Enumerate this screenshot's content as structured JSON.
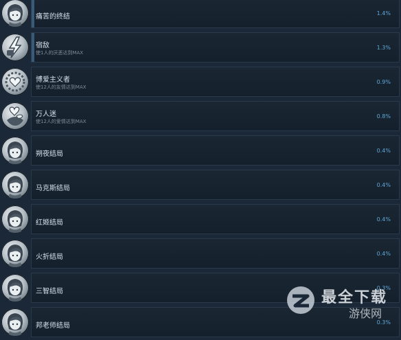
{
  "achievements": [
    {
      "title": "痛苦的终结",
      "desc": "",
      "percent": "1.4%",
      "icon": "anime-character-icon",
      "has_bar": true
    },
    {
      "title": "宿敌",
      "desc": "使1人的厌恶达到MAX",
      "percent": "1.3%",
      "icon": "lightning-fist-icon",
      "has_bar": true
    },
    {
      "title": "博爱主义者",
      "desc": "使12人的友情达到MAX",
      "percent": "0.9%",
      "icon": "heart-ring-icon",
      "has_bar": false
    },
    {
      "title": "万人迷",
      "desc": "使12人的爱情达到MAX",
      "percent": "0.8%",
      "icon": "heart-bouquet-icon",
      "has_bar": false
    },
    {
      "title": "朔夜结局",
      "desc": "",
      "percent": "0.4%",
      "icon": "anime-character-icon",
      "has_bar": false
    },
    {
      "title": "马克斯结局",
      "desc": "",
      "percent": "0.4%",
      "icon": "anime-character-icon",
      "has_bar": false
    },
    {
      "title": "红姬结局",
      "desc": "",
      "percent": "0.4%",
      "icon": "anime-character-icon",
      "has_bar": false
    },
    {
      "title": "火折结局",
      "desc": "",
      "percent": "0.4%",
      "icon": "anime-character-icon",
      "has_bar": false
    },
    {
      "title": "三智结局",
      "desc": "",
      "percent": "0.3%",
      "icon": "anime-character-icon",
      "has_bar": false
    },
    {
      "title": "邦老师结局",
      "desc": "",
      "percent": "0.3%",
      "icon": "anime-character-icon",
      "has_bar": false
    }
  ],
  "watermark": {
    "main": "最全下载",
    "sub": "游侠网"
  },
  "colors": {
    "background": "#1b2838",
    "percent": "#5fa8d8",
    "title": "#d6e0ea"
  }
}
